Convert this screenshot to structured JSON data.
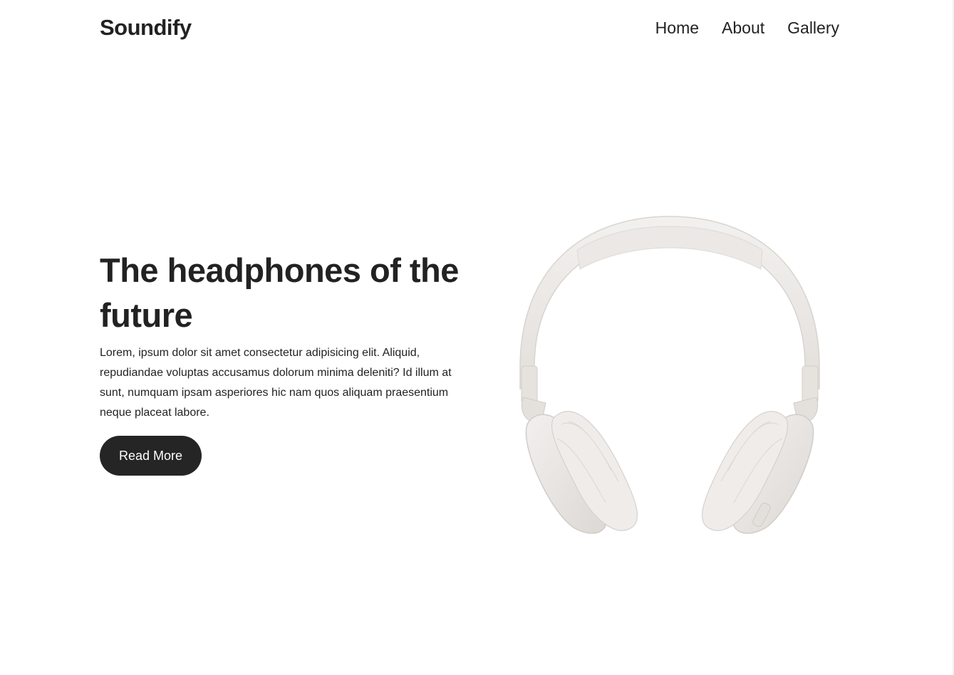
{
  "header": {
    "brand": "Soundify",
    "nav": [
      {
        "label": "Home"
      },
      {
        "label": "About"
      },
      {
        "label": "Gallery"
      }
    ]
  },
  "hero": {
    "title": "The headphones of the future",
    "description": "Lorem, ipsum dolor sit amet consectetur adipisicing elit. Aliquid, repudiandae voluptas accusamus dolorum minima deleniti? Id illum at sunt, numquam ipsam asperiores hic nam quos aliquam praesentium neque placeat labore.",
    "cta_label": "Read More",
    "image_icon": "headphones-image"
  },
  "colors": {
    "text": "#222222",
    "button_bg": "#252525",
    "button_text": "#ffffff",
    "headphones": "#ece9e6"
  }
}
